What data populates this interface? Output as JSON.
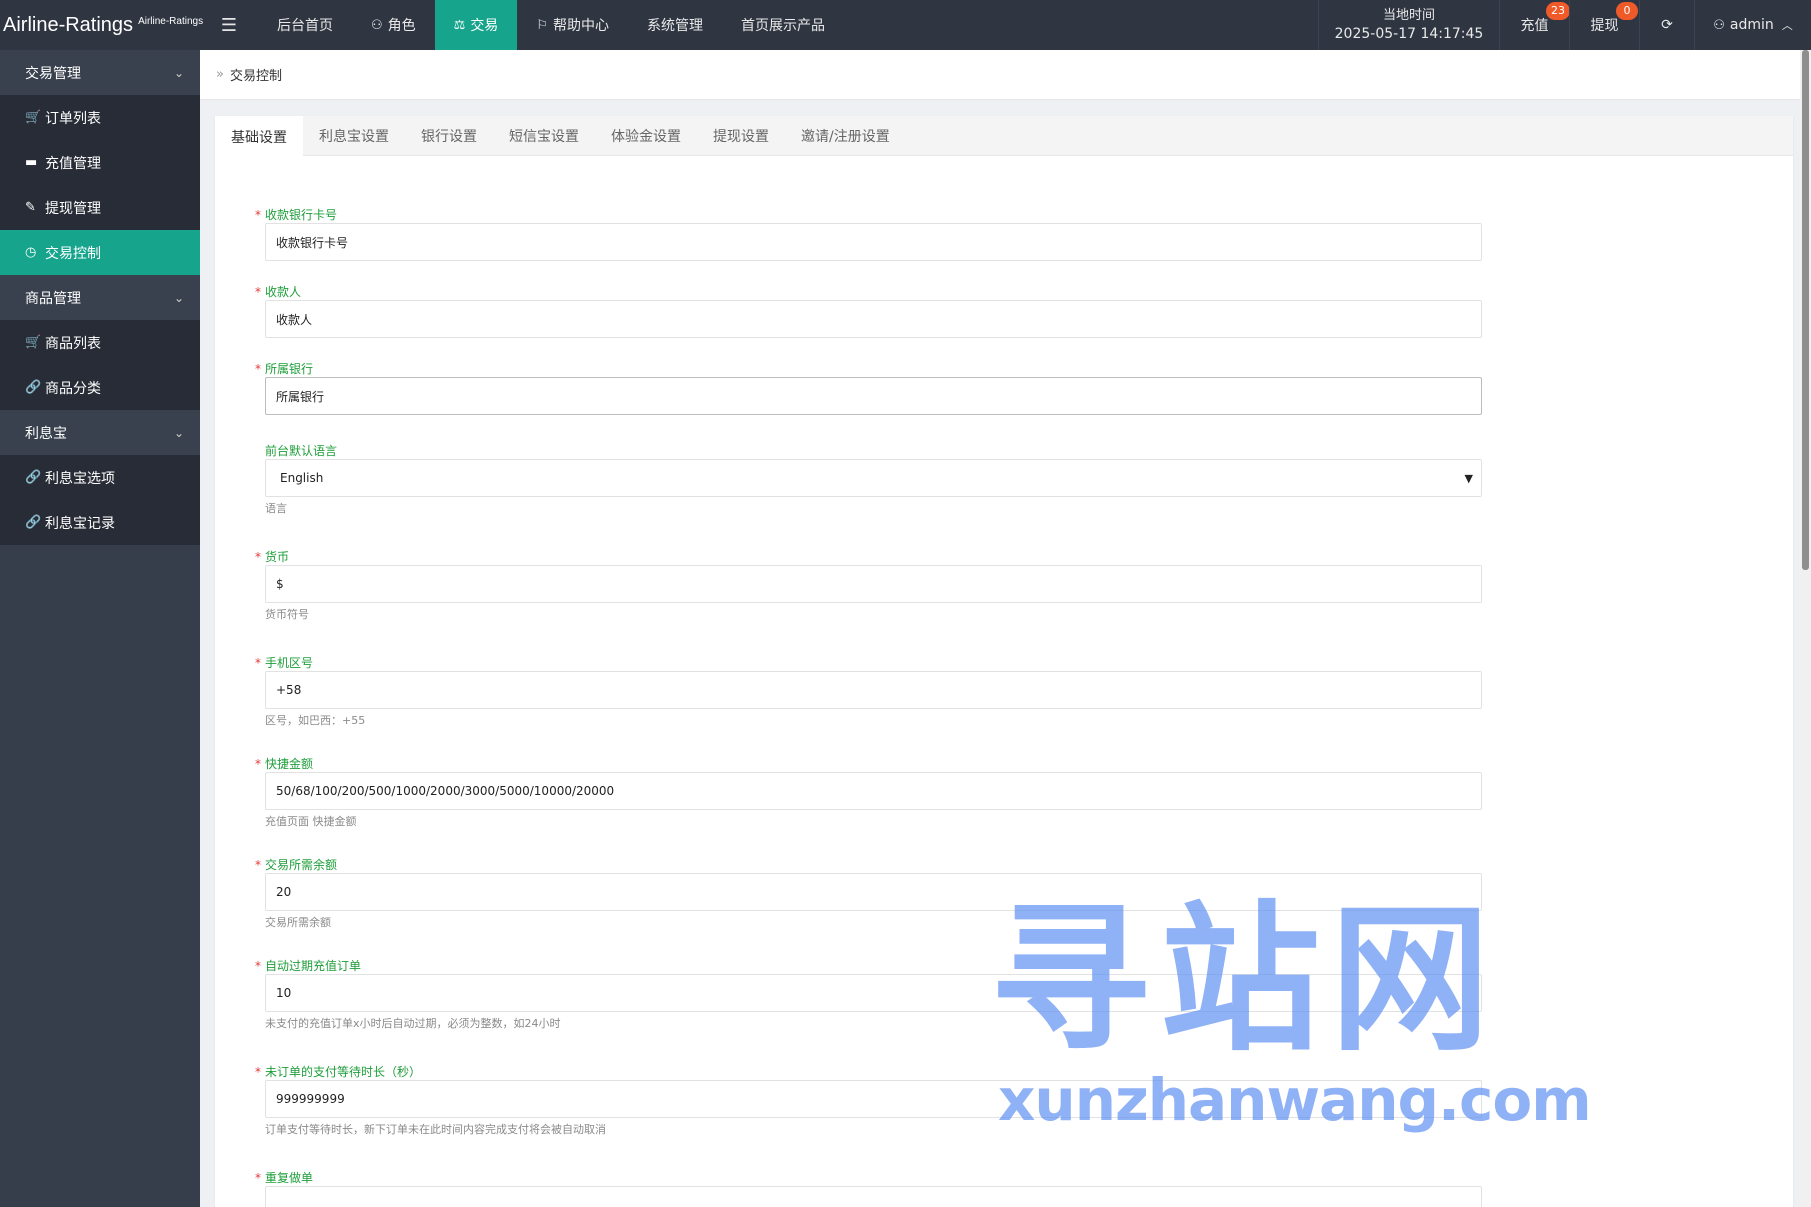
{
  "brand": {
    "name": "Airline-Ratings",
    "sub": "Airline-Ratings"
  },
  "topnav": {
    "toggle_icon": "☰",
    "items": [
      {
        "label": "后台首页",
        "icon": ""
      },
      {
        "label": "角色",
        "icon": "⚇"
      },
      {
        "label": "交易",
        "icon": "⚖"
      },
      {
        "label": "帮助中心",
        "icon": "⚐"
      },
      {
        "label": "系统管理",
        "icon": ""
      },
      {
        "label": "首页展示产品",
        "icon": ""
      }
    ],
    "active": "交易"
  },
  "topright": {
    "time_label": "当地时间",
    "time_value": "2025-05-17 14:17:45",
    "recharge_label": "充值",
    "recharge_badge": "23",
    "withdraw_label": "提现",
    "withdraw_badge": "0",
    "refresh_icon": "⟳",
    "user_icon": "⚇",
    "user_name": "admin",
    "user_caret": "︿"
  },
  "sidebar": {
    "groups": [
      {
        "label": "交易管理",
        "items": [
          {
            "label": "订单列表",
            "icon": "🛒"
          },
          {
            "label": "充值管理",
            "icon": "▬"
          },
          {
            "label": "提现管理",
            "icon": "✎"
          },
          {
            "label": "交易控制",
            "icon": "◷"
          }
        ]
      },
      {
        "label": "商品管理",
        "items": [
          {
            "label": "商品列表",
            "icon": "🛒"
          },
          {
            "label": "商品分类",
            "icon": "🔗"
          }
        ]
      },
      {
        "label": "利息宝",
        "items": [
          {
            "label": "利息宝选项",
            "icon": "🔗"
          },
          {
            "label": "利息宝记录",
            "icon": "🔗"
          }
        ]
      }
    ],
    "chevron": "⌄"
  },
  "breadcrumb": {
    "separator": "»",
    "current": "交易控制"
  },
  "tabs": [
    "基础设置",
    "利息宝设置",
    "银行设置",
    "短信宝设置",
    "体验金设置",
    "提现设置",
    "邀请/注册设置"
  ],
  "active_tab": "基础设置",
  "form": {
    "bank_card": {
      "label": "收款银行卡号",
      "value": "收款银行卡号"
    },
    "payee": {
      "label": "收款人",
      "value": "收款人"
    },
    "bank": {
      "label": "所属银行",
      "value": "所属银行"
    },
    "language": {
      "label": "前台默认语言",
      "value": "English",
      "help": "语言"
    },
    "currency": {
      "label": "货币",
      "value": "$",
      "help": "货币符号"
    },
    "phone_code": {
      "label": "手机区号",
      "value": "+58",
      "help": "区号，如巴西：+55"
    },
    "quick_amount": {
      "label": "快捷金额",
      "value": "50/68/100/200/500/1000/2000/3000/5000/10000/20000",
      "help": "充值页面 快捷金额"
    },
    "required_balance": {
      "label": "交易所需余额",
      "value": "20",
      "help": "交易所需余额"
    },
    "auto_expire": {
      "label": "自动过期充值订单",
      "value": "10",
      "help": "未支付的充值订单x小时后自动过期，必须为整数，如24小时"
    },
    "wait_time": {
      "label": "未订单的支付等待时长（秒）",
      "value": "999999999",
      "help": "订单支付等待时长，新下订单未在此时间内容完成支付将会被自动取消"
    },
    "repeat_order": {
      "label": "重复做单"
    }
  },
  "watermark": {
    "big": "寻站网",
    "small": "xunzhanwang.com"
  }
}
